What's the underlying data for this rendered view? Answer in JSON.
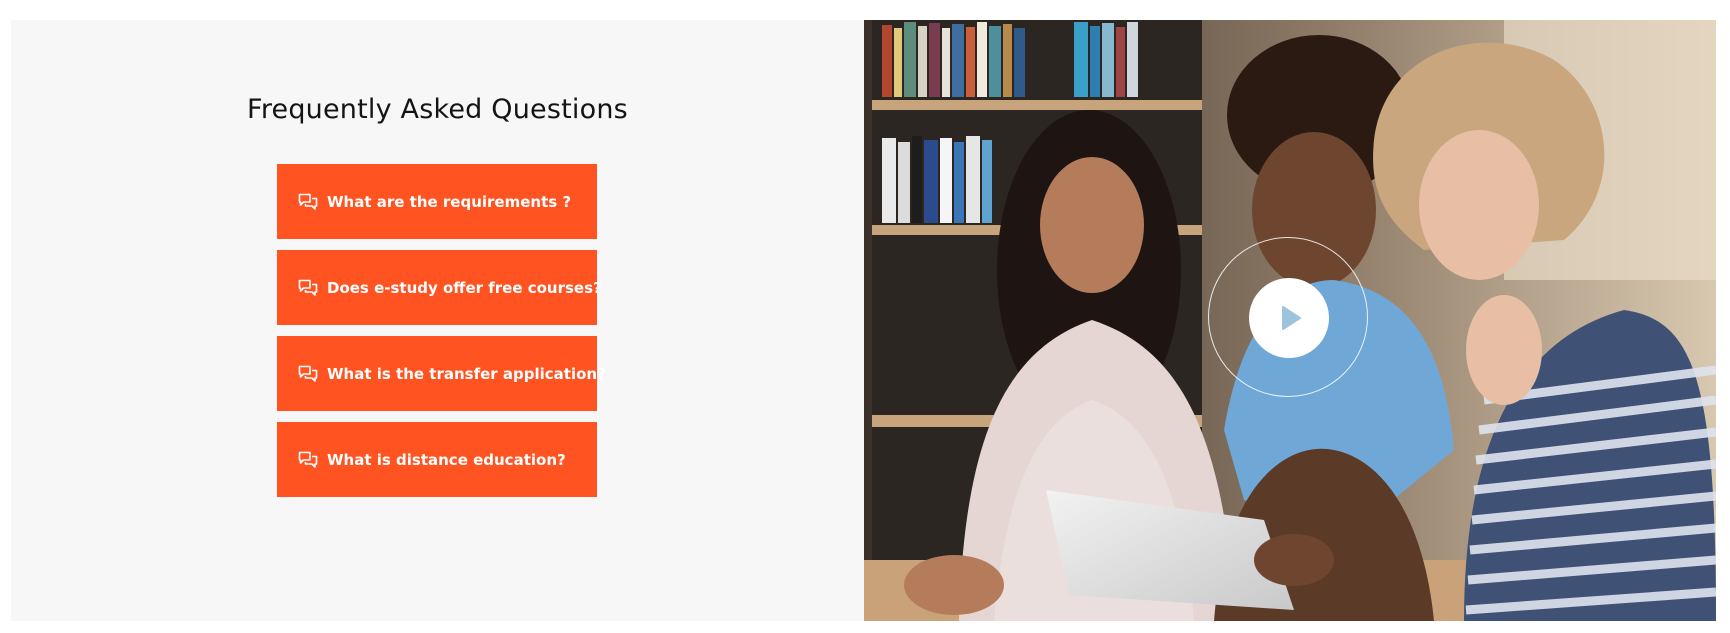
{
  "faq": {
    "title": "Frequently Asked Questions",
    "items": [
      {
        "label": "What are the requirements ?",
        "icon": "chat-bubbles-icon"
      },
      {
        "label": "Does e-study offer free courses?",
        "icon": "chat-bubbles-icon"
      },
      {
        "label": "What is the transfer application?",
        "icon": "chat-bubbles-icon"
      },
      {
        "label": "What is distance education?",
        "icon": "chat-bubbles-icon"
      }
    ]
  },
  "video": {
    "play_icon": "play-icon"
  },
  "colors": {
    "accent": "#ff5421",
    "panel_bg": "#f7f7f7",
    "play_icon": "#9ec3dd"
  }
}
